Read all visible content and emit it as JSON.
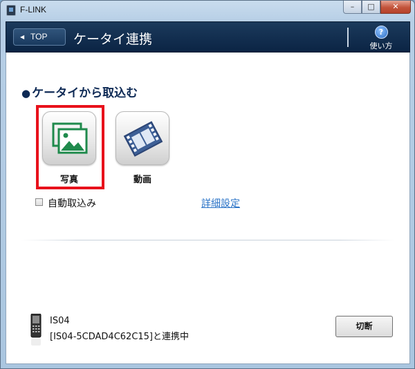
{
  "window": {
    "title": "F-LINK",
    "icon": "app-icon",
    "controls": {
      "minimize": "–",
      "maximize": "□",
      "close": "✕"
    }
  },
  "header": {
    "back_label": "TOP",
    "back_arrow": "◀",
    "title": "ケータイ連携",
    "help_label": "使い方",
    "help_symbol": "?"
  },
  "section": {
    "bullet": "●",
    "title": "ケータイから取込む"
  },
  "actions": [
    {
      "label": "写真",
      "icon": "photo-icon",
      "selected": true
    },
    {
      "label": "動画",
      "icon": "film-icon",
      "selected": false
    }
  ],
  "auto_import": {
    "label": "自動取込み",
    "checked": false
  },
  "detail_settings_link": "詳細設定",
  "device": {
    "name": "IS04",
    "status": "[IS04-5CDAD4C62C15]と連携中",
    "icon": "phone-icon"
  },
  "disconnect_label": "切断",
  "colors": {
    "header_bg": "#0b2444",
    "highlight": "#e8111b",
    "link": "#2a73c7",
    "title_text": "#0e2a55"
  }
}
